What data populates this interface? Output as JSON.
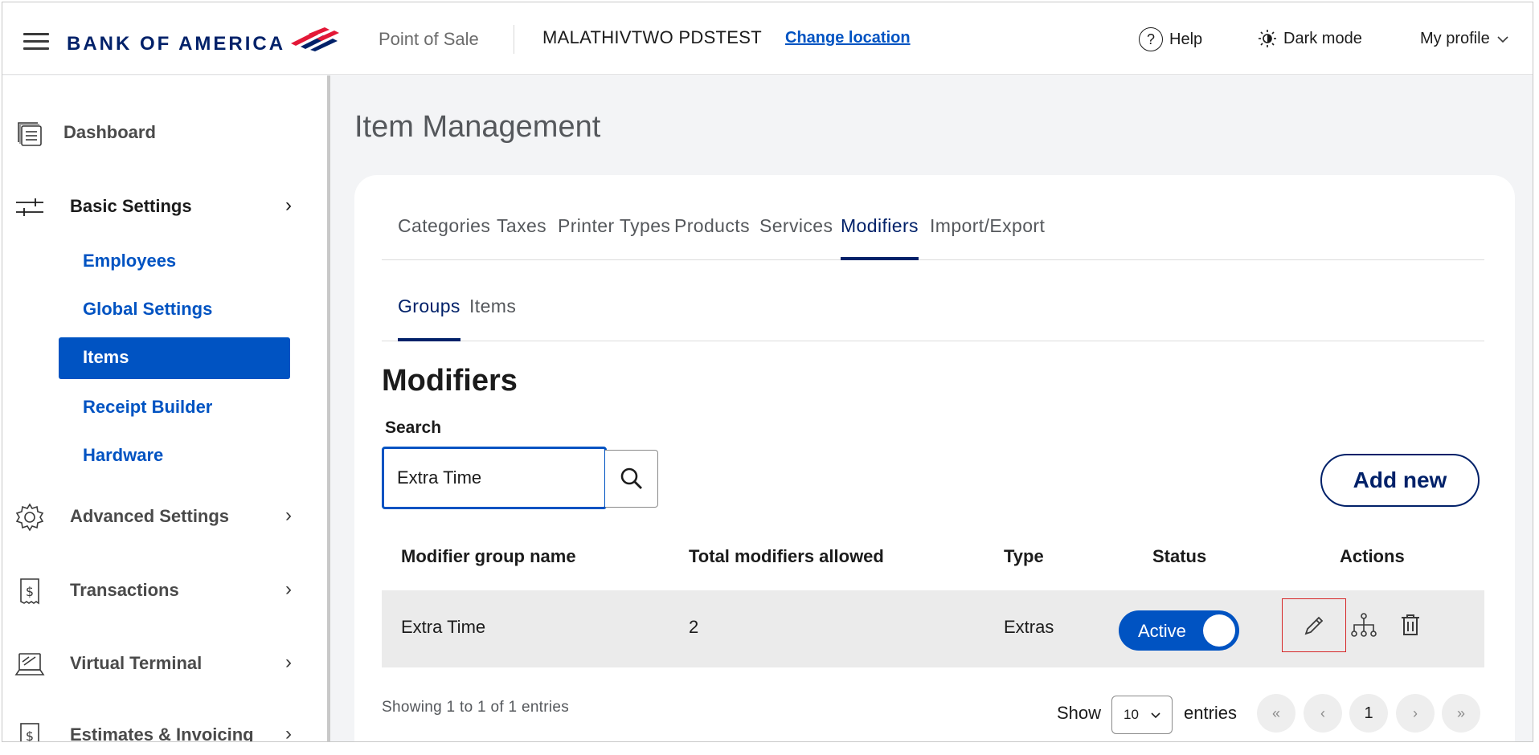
{
  "header": {
    "brand": "BANK OF AMERICA",
    "app_name": "Point of Sale",
    "merchant": "MALATHIVTWO PDSTEST",
    "change_location": "Change location",
    "help": "Help",
    "dark_mode": "Dark mode",
    "profile": "My profile"
  },
  "sidebar": {
    "dashboard": "Dashboard",
    "basic_settings": "Basic Settings",
    "sub_items": [
      "Employees",
      "Global Settings",
      "Items",
      "Receipt Builder",
      "Hardware"
    ],
    "advanced_settings": "Advanced Settings",
    "transactions": "Transactions",
    "virtual_terminal": "Virtual Terminal",
    "estimates": "Estimates & Invoicing"
  },
  "page": {
    "title": "Item Management",
    "tabs": [
      "Categories",
      "Taxes",
      "Printer Types",
      "Products",
      "Services",
      "Modifiers",
      "Import/Export"
    ],
    "active_tab": "Modifiers",
    "subtabs": [
      "Groups",
      "Items"
    ],
    "active_subtab": "Groups",
    "section_title": "Modifiers",
    "search_label": "Search",
    "search_value": "Extra Time",
    "add_new": "Add new"
  },
  "table": {
    "headers": [
      "Modifier group name",
      "Total modifiers allowed",
      "Type",
      "Status",
      "Actions"
    ],
    "rows": [
      {
        "name": "Extra Time",
        "total": "2",
        "type": "Extras",
        "status": "Active"
      }
    ]
  },
  "footer": {
    "showing": "Showing 1 to 1 of 1 entries",
    "show": "Show",
    "page_size": "10",
    "entries": "entries",
    "first": "«",
    "prev": "‹",
    "current_page": "1",
    "next": "›",
    "last": "»"
  },
  "colors": {
    "brand_navy": "#012169",
    "accent_blue": "#0053c2",
    "brand_red": "#e31837",
    "highlight_red": "#d62728"
  },
  "icons": [
    "menu-icon",
    "search-icon",
    "help-icon",
    "dark-mode-icon",
    "chevron-down-icon",
    "dashboard-icon",
    "sliders-icon",
    "gear-icon",
    "receipt-dollar-icon",
    "terminal-icon",
    "invoice-dollar-icon",
    "pencil-icon",
    "hierarchy-icon",
    "trash-icon"
  ]
}
